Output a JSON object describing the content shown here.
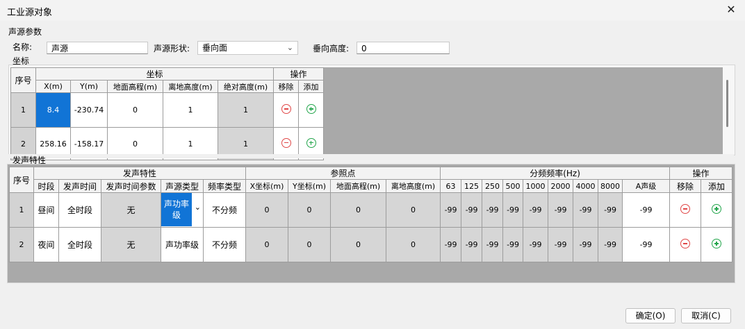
{
  "window": {
    "title": "工业源对象",
    "close_glyph": "✕"
  },
  "params": {
    "section": "声源参数",
    "name_label": "名称:",
    "name_value": "声源",
    "shape_label": "声源形状:",
    "shape_value": "垂向面",
    "height_label": "垂向高度:",
    "height_value": "0"
  },
  "coords": {
    "section": "坐标",
    "headers": {
      "seq": "序号",
      "group": "坐标",
      "ops": "操作",
      "x": "X(m)",
      "y": "Y(m)",
      "ground": "地面高程(m)",
      "above": "离地高度(m)",
      "abs": "绝对高度(m)",
      "remove": "移除",
      "add": "添加"
    },
    "rows": [
      {
        "seq": "1",
        "x": "8.4",
        "y": "-230.74",
        "ground": "0",
        "above": "1",
        "abs": "1"
      },
      {
        "seq": "2",
        "x": "258.16",
        "y": "-158.17",
        "ground": "0",
        "above": "1",
        "abs": "1"
      }
    ]
  },
  "emission": {
    "section": "发声特性",
    "headers": {
      "seq": "序号",
      "group1": "发声特性",
      "group2": "参照点",
      "group3": "分频频率(Hz)",
      "ops": "操作",
      "period": "时段",
      "time": "发声时间",
      "time_param": "发声时间参数",
      "src_type": "声源类型",
      "freq_type": "频率类型",
      "ref_x": "X坐标(m)",
      "ref_y": "Y坐标(m)",
      "ref_ground": "地面高程(m)",
      "ref_above": "离地高度(m)",
      "f63": "63",
      "f125": "125",
      "f250": "250",
      "f500": "500",
      "f1000": "1000",
      "f2000": "2000",
      "f4000": "4000",
      "f8000": "8000",
      "a_level": "A声级",
      "remove": "移除",
      "add": "添加"
    },
    "rows": [
      {
        "seq": "1",
        "period": "昼间",
        "time": "全时段",
        "time_param": "无",
        "src_type": "声功率级",
        "freq_type": "不分频",
        "ref_x": "0",
        "ref_y": "0",
        "ref_ground": "0",
        "ref_above": "0",
        "f63": "-99",
        "f125": "-99",
        "f250": "-99",
        "f500": "-99",
        "f1000": "-99",
        "f2000": "-99",
        "f4000": "-99",
        "f8000": "-99",
        "a_level": "-99"
      },
      {
        "seq": "2",
        "period": "夜间",
        "time": "全时段",
        "time_param": "无",
        "src_type": "声功率级",
        "freq_type": "不分频",
        "ref_x": "0",
        "ref_y": "0",
        "ref_ground": "0",
        "ref_above": "0",
        "f63": "-99",
        "f125": "-99",
        "f250": "-99",
        "f500": "-99",
        "f1000": "-99",
        "f2000": "-99",
        "f4000": "-99",
        "f8000": "-99",
        "a_level": "-99"
      }
    ]
  },
  "buttons": {
    "ok": "确定(O)",
    "cancel": "取消(C)"
  },
  "colors": {
    "selection": "#1174d6",
    "remove": "#e04646",
    "add": "#22a54b"
  }
}
